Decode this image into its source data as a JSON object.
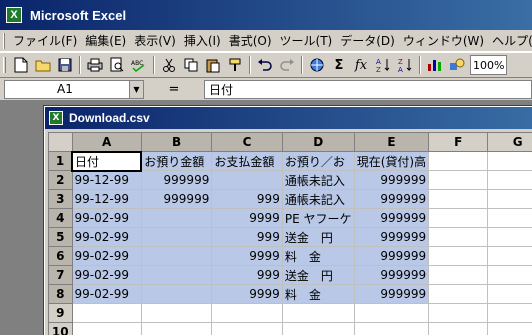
{
  "window": {
    "title": "Microsoft Excel",
    "icon": "excel-icon"
  },
  "menu": [
    "ファイル(F)",
    "編集(E)",
    "表示(V)",
    "挿入(I)",
    "書式(O)",
    "ツール(T)",
    "データ(D)",
    "ウィンドウ(W)",
    "ヘルプ(H)"
  ],
  "toolbar": {
    "icons": [
      "new-icon",
      "open-icon",
      "save-icon",
      "print-icon",
      "print-preview-icon",
      "spelling-icon",
      "cut-icon",
      "copy-icon",
      "paste-icon",
      "format-painter-icon",
      "undo-icon",
      "redo-icon",
      "hyperlink-icon",
      "autosum-icon",
      "function-icon",
      "sort-ascending-icon",
      "sort-descending-icon",
      "chart-wizard-icon",
      "drawing-icon"
    ],
    "zoom": "100%"
  },
  "formula_bar": {
    "name_box": "A1",
    "equals": "=",
    "content": "日付"
  },
  "workbook": {
    "title": "Download.csv"
  },
  "sheet": {
    "columns": [
      "A",
      "B",
      "C",
      "D",
      "E",
      "F",
      "G"
    ],
    "rows": [
      {
        "num": "1",
        "cells": [
          "日付",
          "お預り金額",
          "お支払金額",
          "お預り／お",
          "現在(貸付)高",
          "",
          ""
        ]
      },
      {
        "num": "2",
        "cells": [
          "99-12-99",
          "999999",
          "",
          "通帳未記入",
          "999999",
          "",
          ""
        ]
      },
      {
        "num": "3",
        "cells": [
          "99-12-99",
          "999999",
          "999",
          "通帳未記入",
          "999999",
          "",
          ""
        ]
      },
      {
        "num": "4",
        "cells": [
          "99-02-99",
          "",
          "9999",
          "PE ヤフーケ",
          "999999",
          "",
          ""
        ]
      },
      {
        "num": "5",
        "cells": [
          "99-02-99",
          "",
          "999",
          "送金　円",
          "999999",
          "",
          ""
        ]
      },
      {
        "num": "6",
        "cells": [
          "99-02-99",
          "",
          "9999",
          "料　金",
          "999999",
          "",
          ""
        ]
      },
      {
        "num": "7",
        "cells": [
          "99-02-99",
          "",
          "999",
          "送金　円",
          "999999",
          "",
          ""
        ]
      },
      {
        "num": "8",
        "cells": [
          "99-02-99",
          "",
          "9999",
          "料　金",
          "999999",
          "",
          ""
        ]
      },
      {
        "num": "9",
        "cells": [
          "",
          "",
          "",
          "",
          "",
          "",
          ""
        ]
      },
      {
        "num": "10",
        "cells": [
          "",
          "",
          "",
          "",
          "",
          "",
          ""
        ]
      }
    ]
  },
  "colors": {
    "titlebar": "#0a246a",
    "selection": "#b9c8e6",
    "chrome": "#d4d0c8"
  }
}
